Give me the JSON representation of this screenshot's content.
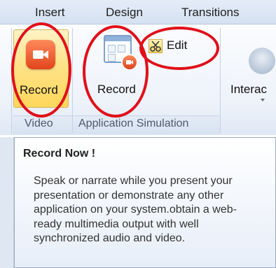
{
  "tabs": [
    "Insert",
    "Design",
    "Transitions"
  ],
  "groups": {
    "video": {
      "label": "Video",
      "record_label": "Record"
    },
    "application_simulation": {
      "label": "Application Simulation",
      "record_label": "Record",
      "edit_label": "Edit"
    },
    "interaction": {
      "label": "Interac"
    }
  },
  "tooltip": {
    "title": "Record Now !",
    "body": "Speak or narrate while you present your presentation or demonstrate any other application on your system.obtain a web-ready multimedia output with well synchronized audio and video."
  },
  "colors": {
    "annotation": "#e0101a",
    "record_icon": "#e1451c",
    "selected_button": "#ffd75a"
  }
}
